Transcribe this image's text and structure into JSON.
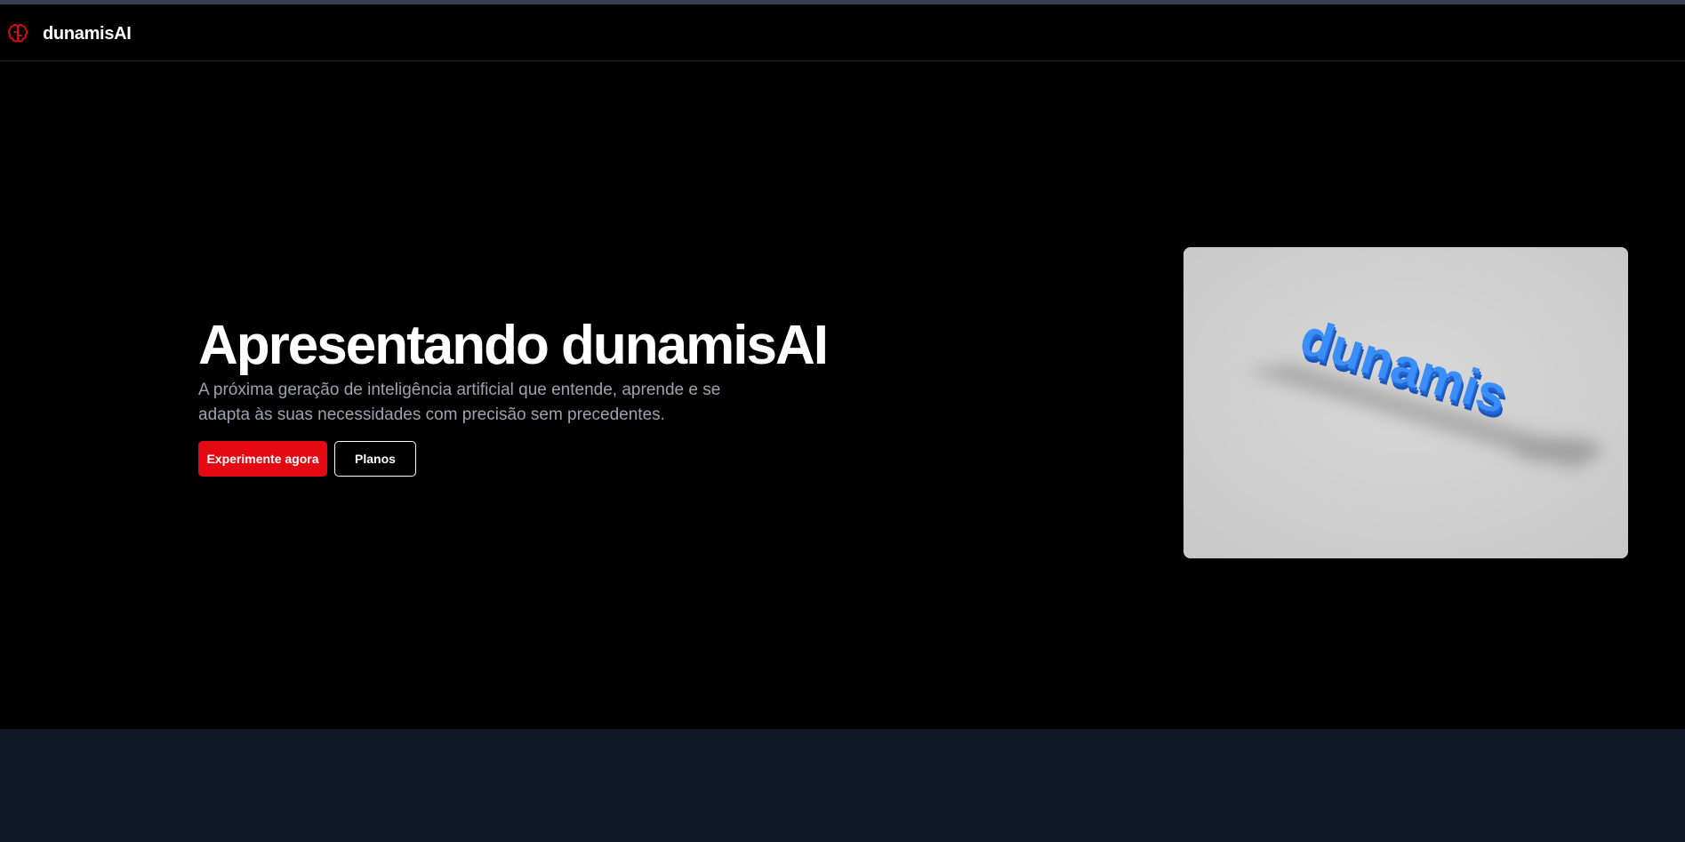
{
  "brand": {
    "name": "dunamisAI",
    "icon": "brain-icon",
    "accent_color": "#e50914"
  },
  "hero": {
    "title": "Apresentando dunamisAI",
    "subtitle": "A próxima geração de inteligência artificial que entende, aprende e se adapta às suas necessidades com precisão sem precedentes.",
    "primary_button": "Experimente agora",
    "secondary_button": "Planos",
    "image": {
      "logo_text": "dunamis",
      "text_color": "#2f86f6",
      "background_color": "#cfcfcf"
    }
  },
  "colors": {
    "page_background": "#000000",
    "footer_background": "#111827",
    "subtitle_text": "#9ca3af"
  }
}
